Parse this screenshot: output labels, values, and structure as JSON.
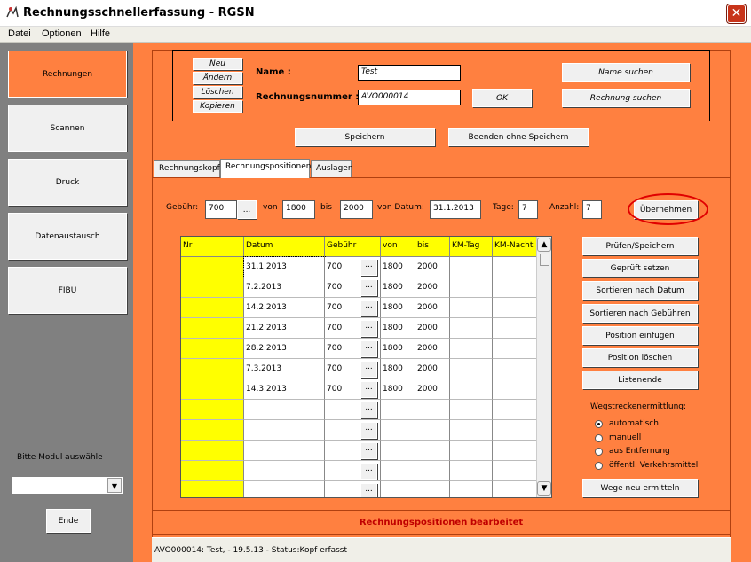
{
  "window": {
    "title": "Rechnungsschnellerfassung - RGSN",
    "close": "✕"
  },
  "menu": [
    "Datei",
    "Optionen",
    "Hilfe"
  ],
  "sidebar": {
    "items": [
      "Rechnungen",
      "Scannen",
      "Druck",
      "Datenaustausch",
      "FIBU"
    ],
    "module_label": "Bitte Modul auswähle",
    "module_value": "",
    "end_button": "Ende"
  },
  "header": {
    "actions": [
      "Neu",
      "Ändern",
      "Löschen",
      "Kopieren"
    ],
    "name_label": "Name :",
    "name_value": "Test",
    "number_label": "Rechnungsnummer :",
    "number_value": "AVO000014",
    "ok_button": "OK",
    "search_name_button": "Name suchen",
    "search_invoice_button": "Rechnung suchen"
  },
  "save_button": "Speichern",
  "exit_button": "Beenden ohne Speichern",
  "tabs": [
    "Rechnungskopf",
    "Rechnungspositionen",
    "Auslagen"
  ],
  "selected_tab": "Rechnungspositionen",
  "entry": {
    "gebuehr_label": "Gebühr:",
    "gebuehr_value": "700",
    "von_label": "von",
    "von_value": "1800",
    "bis_label": "bis",
    "bis_value": "2000",
    "datum_label": "von Datum:",
    "datum_value": "31.1.2013",
    "tage_label": "Tage:",
    "tage_value": "7",
    "anzahl_label": "Anzahl:",
    "anzahl_value": "7",
    "apply_button": "Übernehmen",
    "ellipsis": "..."
  },
  "grid": {
    "columns": [
      "Nr",
      "Datum",
      "Gebühr",
      "von",
      "bis",
      "KM-Tag",
      "KM-Nacht"
    ],
    "rows": [
      [
        "",
        "31.1.2013",
        "700",
        "1800",
        "2000",
        "",
        ""
      ],
      [
        "",
        "7.2.2013",
        "700",
        "1800",
        "2000",
        "",
        ""
      ],
      [
        "",
        "14.2.2013",
        "700",
        "1800",
        "2000",
        "",
        ""
      ],
      [
        "",
        "21.2.2013",
        "700",
        "1800",
        "2000",
        "",
        ""
      ],
      [
        "",
        "28.2.2013",
        "700",
        "1800",
        "2000",
        "",
        ""
      ],
      [
        "",
        "7.3.2013",
        "700",
        "1800",
        "2000",
        "",
        ""
      ],
      [
        "",
        "14.3.2013",
        "700",
        "1800",
        "2000",
        "",
        ""
      ],
      [
        "",
        "",
        "",
        "",
        "",
        "",
        ""
      ],
      [
        "",
        "",
        "",
        "",
        "",
        "",
        ""
      ],
      [
        "",
        "",
        "",
        "",
        "",
        "",
        ""
      ],
      [
        "",
        "",
        "",
        "",
        "",
        "",
        ""
      ],
      [
        "",
        "",
        "",
        "",
        "",
        "",
        ""
      ]
    ]
  },
  "right_buttons": [
    "Prüfen/Speichern",
    "Geprüft setzen",
    "Sortieren nach Datum",
    "Sortieren nach Gebühren",
    "Position einfügen",
    "Position löschen",
    "Listenende"
  ],
  "route": {
    "title": "Wegstreckenermittlung:",
    "options": [
      "automatisch",
      "manuell",
      "aus Entfernung",
      "öffentl. Verkehrsmittel"
    ],
    "selected": 0,
    "recalc_button": "Wege neu ermitteln"
  },
  "status_message": "Rechnungspositionen bearbeitet",
  "status_line": "AVO000014: Test,  - 19.5.13 - Status:Kopf erfasst",
  "colors": {
    "accent": "#ff8040",
    "highlight": "#ffff00",
    "sidebar": "#808080",
    "alert": "#c00000"
  }
}
